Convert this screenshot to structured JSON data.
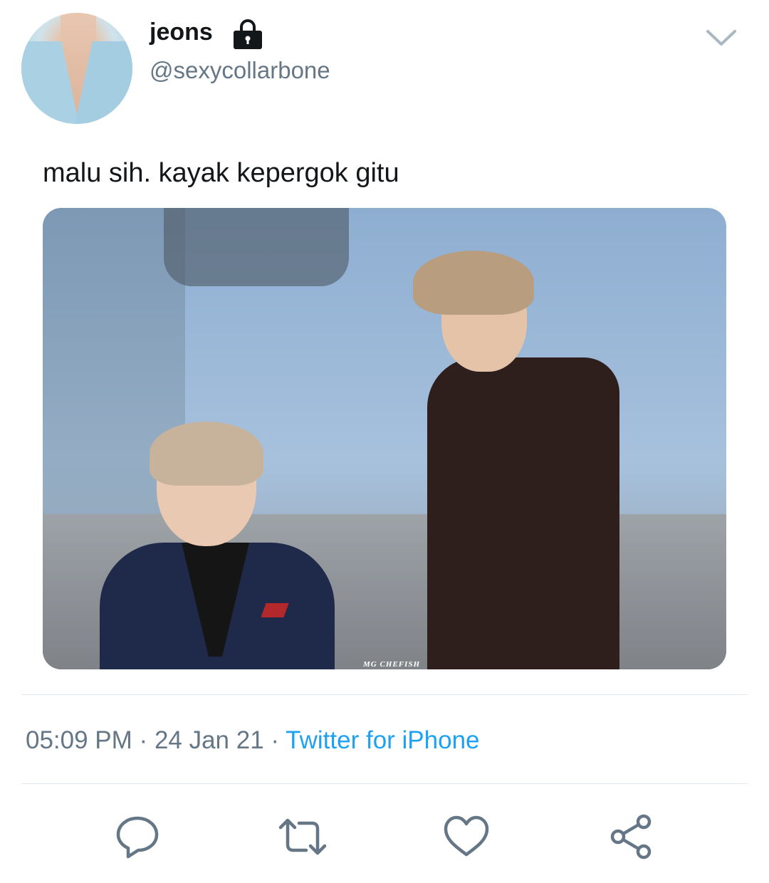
{
  "profile": {
    "display_name": "jeons",
    "handle": "@sexycollarbone",
    "protected_icon": "lock-icon",
    "menu_icon": "chevron-down-icon"
  },
  "tweet": {
    "text": "malu sih. kayak kepergok gitu",
    "image_watermark": "MG CHEFISH",
    "time": "05:09 PM",
    "separator": "·",
    "date": "24 Jan 21",
    "source": "Twitter for iPhone"
  },
  "actions": [
    {
      "name": "reply",
      "icon": "reply-icon"
    },
    {
      "name": "retweet",
      "icon": "retweet-icon"
    },
    {
      "name": "like",
      "icon": "heart-icon"
    },
    {
      "name": "share",
      "icon": "share-icon"
    }
  ],
  "colors": {
    "text": "#14171a",
    "secondary": "#657786",
    "link": "#1da1f2",
    "icon": "#657786"
  }
}
